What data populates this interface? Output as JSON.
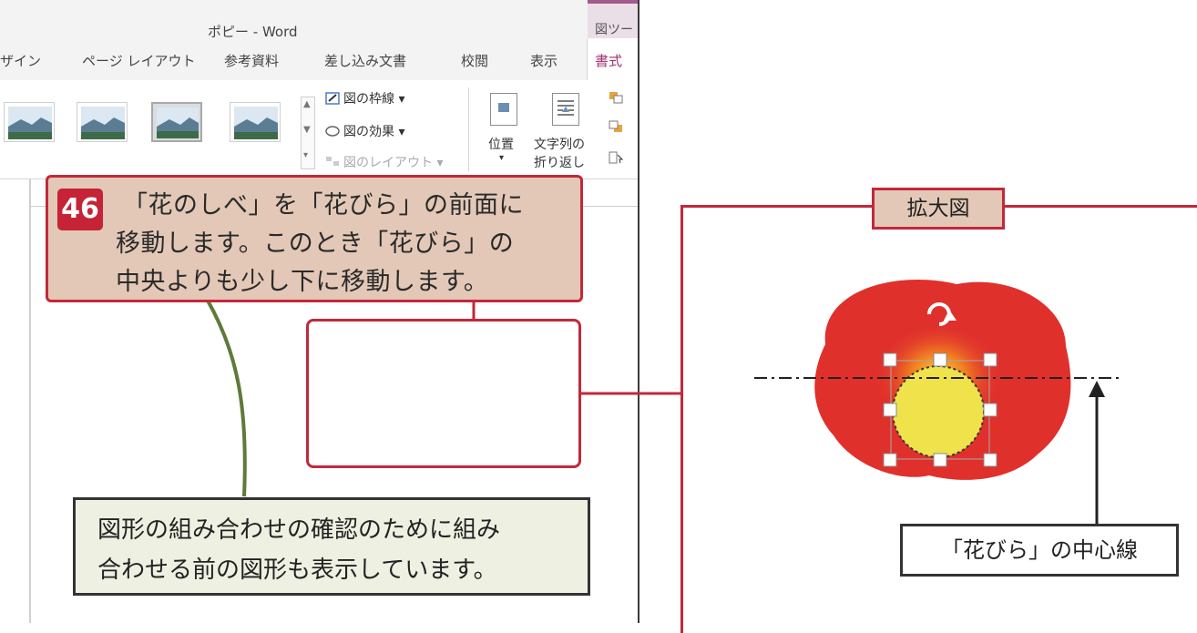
{
  "window": {
    "title": "ポピー - Word",
    "context_tab_label": "図ツー"
  },
  "ribbon": {
    "tabs": [
      {
        "label": "ザイン"
      },
      {
        "label": "ページ レイアウト"
      },
      {
        "label": "参考資料"
      },
      {
        "label": "差し込み文書"
      },
      {
        "label": "校閲"
      },
      {
        "label": "表示"
      },
      {
        "label": "書式"
      }
    ],
    "picture_border": "図の枠線",
    "picture_effects": "図の効果",
    "picture_layout": "図のレイアウト",
    "position": "位置",
    "wrap_text_line1": "文字列の",
    "wrap_text_line2": "折り返し"
  },
  "callout": {
    "step": "46",
    "line1": "「花のしべ」を「花びら」の前面に",
    "line2": "移動します。このとき「花びら」の",
    "line3": "中央よりも少し下に移動します。"
  },
  "note": {
    "line1": "図形の組み合わせの確認のために組み",
    "line2": "合わせる前の図形も表示しています。"
  },
  "zoom": {
    "label": "拡大図",
    "center_line_label": "「花びら」の中心線"
  },
  "colors": {
    "accent_red": "#c3283a",
    "callout_fill": "#e3c8b7",
    "petal_red": "#e0302c",
    "pistil_yellow": "#efe24a",
    "stem_green": "#5e7a3a"
  }
}
